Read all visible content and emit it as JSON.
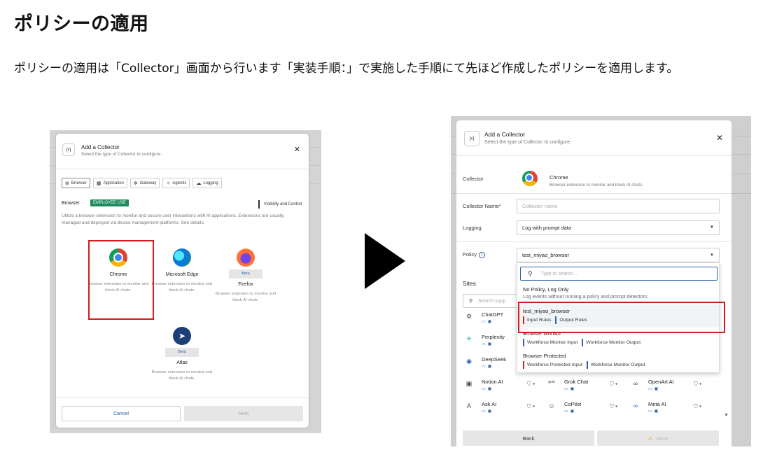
{
  "page": {
    "title": "ポリシーの適用",
    "description": "ポリシーの適用は「Collector」画面から行います「実装手順：」で実施した手順にて先ほど作成したポリシーを適用します。"
  },
  "left": {
    "dialog_title": "Add a Collector",
    "dialog_subtitle": "Select the type of Collector to configure.",
    "tabs": [
      "Browser",
      "Application",
      "Gateway",
      "Agentic",
      "Logging"
    ],
    "section_label": "Browser",
    "badge": "EMPLOYEE USE",
    "visibility": "Visibility and Control",
    "description": "Utilize a browser extension to monitor and secure user interactions with AI applications. Extensions are usually managed and deployed via device management platforms. See details.",
    "apps": [
      {
        "name": "Chrome",
        "desc": "Browser extension to monitor and block AI chats.",
        "icon": "chrome-icon"
      },
      {
        "name": "Microsoft Edge",
        "desc": "Browser extension to monitor and block AI chats.",
        "icon": "edge-icon"
      },
      {
        "name": "Firefox",
        "desc": "Browser extension to monitor and block AI chats.",
        "beta": "Beta",
        "icon": "firefox-icon"
      },
      {
        "name": "Atlas",
        "desc": "Browser extension to monitor and block AI chats.",
        "beta": "Beta",
        "icon": "atlas-icon"
      }
    ],
    "cancel": "Cancel",
    "next": "Next"
  },
  "right": {
    "dialog_title": "Add a Collector",
    "dialog_subtitle": "Select the type of Collector to configure.",
    "collector_label": "Collector",
    "collector_name": "Chrome",
    "collector_desc": "Browser extension to monitor and block AI chats.",
    "collector_name_label": "Collector Name*",
    "collector_name_placeholder": "Collector name",
    "logging_label": "Logging",
    "logging_value": "Log with prompt data",
    "policy_label": "Policy",
    "policy_value": "test_miyao_browser",
    "search_placeholder": "Type to search...",
    "options": [
      {
        "name": "No Policy, Log Only",
        "desc": "Log events without running a policy and prompt detectors."
      },
      {
        "name": "test_miyao_browser",
        "tags": [
          "Input Rules",
          "Output Rules"
        ]
      },
      {
        "name": "Browser Monitor",
        "tags": [
          "Workforce Monitor Input",
          "Workforce Monitor Output"
        ]
      },
      {
        "name": "Browser Protected",
        "tags": [
          "Workforce Protected Input",
          "Workforce Monitor Output"
        ]
      }
    ],
    "sites_label": "Sites",
    "sites_search": "Search supp",
    "sites": [
      "ChatGPT",
      "Perplexity",
      "DeepSeek",
      "Notion AI",
      "Ask AI",
      "Grok Chat",
      "CoPilot",
      "OpenArt AI",
      "Meta AI"
    ],
    "back": "Back",
    "save": "Save"
  },
  "colors": {
    "highlight": "#d81b1b",
    "accent": "#2b5ea7",
    "badge": "#1f8a5b"
  }
}
